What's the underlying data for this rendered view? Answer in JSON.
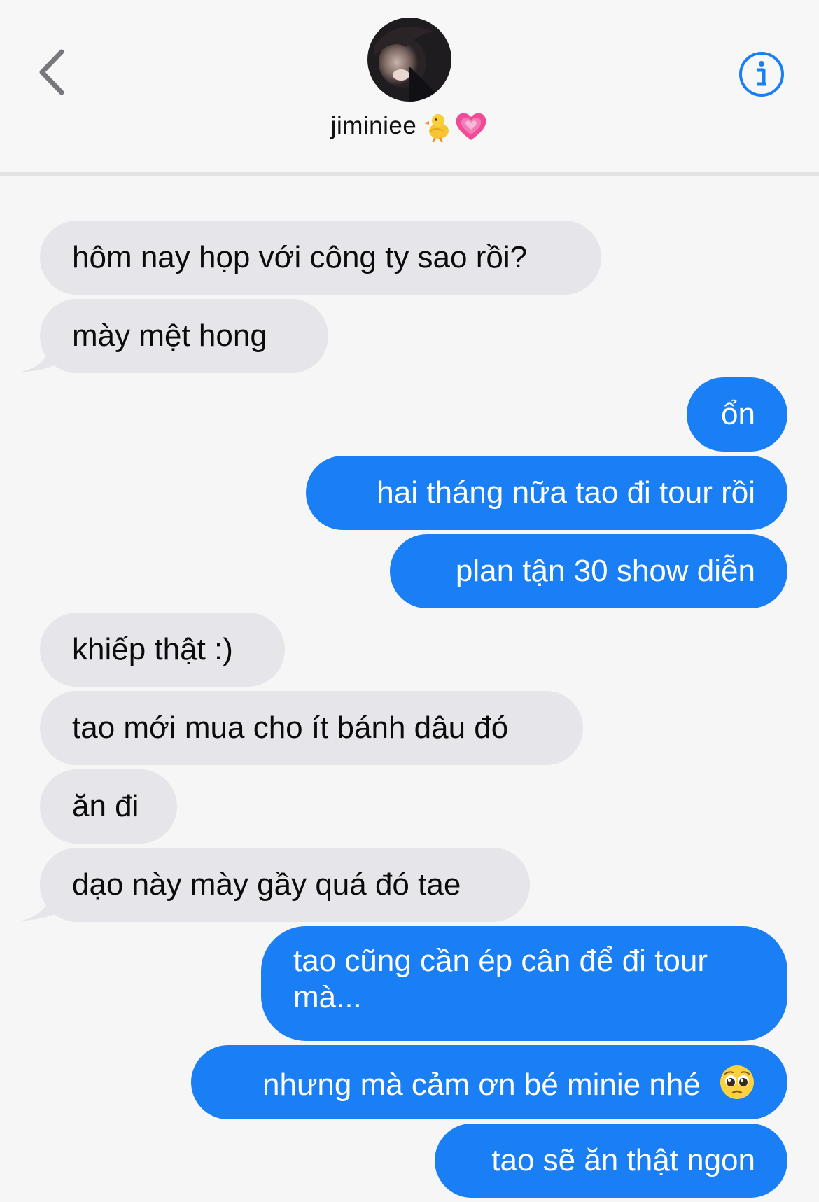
{
  "header": {
    "back_label": "Back",
    "contact_name": "jiminiee",
    "info_label": "Details"
  },
  "messages": [
    {
      "from": "contact",
      "text": "hôm nay họp với công ty sao rồi?"
    },
    {
      "from": "contact",
      "text": "mày mệt hong"
    },
    {
      "from": "me",
      "text": "ổn"
    },
    {
      "from": "me",
      "text": "hai tháng nữa tao đi tour rồi"
    },
    {
      "from": "me",
      "text": "plan tận 30 show diễn"
    },
    {
      "from": "contact",
      "text": "khiếp thật :)"
    },
    {
      "from": "contact",
      "text": "tao mới mua cho ít bánh dâu đó"
    },
    {
      "from": "contact",
      "text": "ăn đi"
    },
    {
      "from": "contact",
      "text": "dạo này mày gầy quá đó tae"
    },
    {
      "from": "me",
      "text": "tao cũng cần ép cân để đi tour mà..."
    },
    {
      "from": "me",
      "text": "nhưng mà cảm ơn bé minie nhé"
    },
    {
      "from": "me",
      "text": "tao sẽ ăn thật ngon"
    }
  ],
  "icons": {
    "back": "chevron-left-icon",
    "info": "info-circle-icon",
    "name_emoji_1": "baby-chick-emoji",
    "name_emoji_2": "growing-heart-emoji",
    "message_emoji": "pleading-face-emoji"
  },
  "colors": {
    "sent_bubble": "#1a7ff5",
    "received_bubble": "#e5e5ea",
    "accent": "#1a7ff5",
    "background": "#f6f6f7"
  }
}
